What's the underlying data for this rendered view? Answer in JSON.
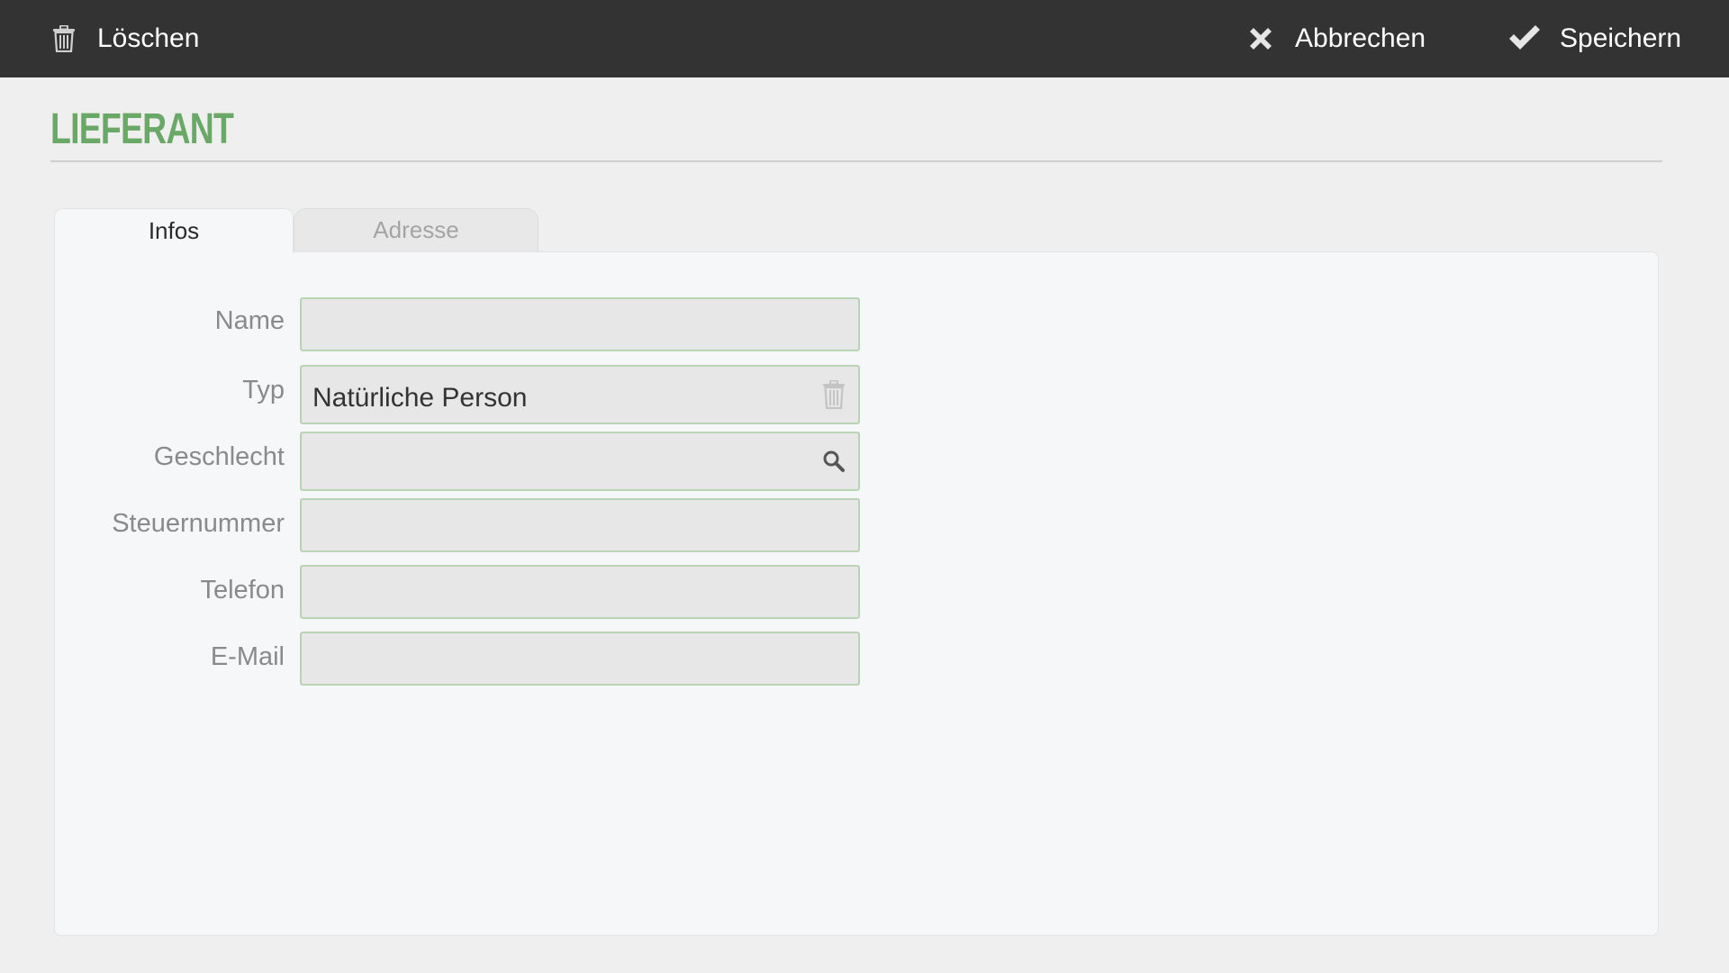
{
  "toolbar": {
    "delete_label": "Löschen",
    "cancel_label": "Abbrechen",
    "save_label": "Speichern",
    "delete_icon": "trash-icon",
    "cancel_icon": "close-icon",
    "save_icon": "checkmark-icon"
  },
  "page": {
    "title": "LIEFERANT"
  },
  "tabs": [
    {
      "label": "Infos",
      "active": true
    },
    {
      "label": "Adresse",
      "active": false
    }
  ],
  "form": {
    "name": {
      "label": "Name",
      "value": "",
      "placeholder": ""
    },
    "typ": {
      "label": "Typ",
      "value": "Natürliche Person",
      "icon": "trash-icon"
    },
    "geschlecht": {
      "label": "Geschlecht",
      "value": "",
      "placeholder": "",
      "icon": "search-icon"
    },
    "steuernummer": {
      "label": "Steuernummer",
      "value": "",
      "placeholder": ""
    },
    "telefon": {
      "label": "Telefon",
      "value": "",
      "placeholder": ""
    },
    "email": {
      "label": "E-Mail",
      "value": "",
      "placeholder": ""
    }
  },
  "colors": {
    "toolbar_bg": "#333333",
    "accent_green": "#6aa868",
    "field_border": "#b9d3b5",
    "field_bg": "#e7e7e7",
    "panel_bg": "#f6f7f9",
    "page_bg": "#efefef"
  }
}
